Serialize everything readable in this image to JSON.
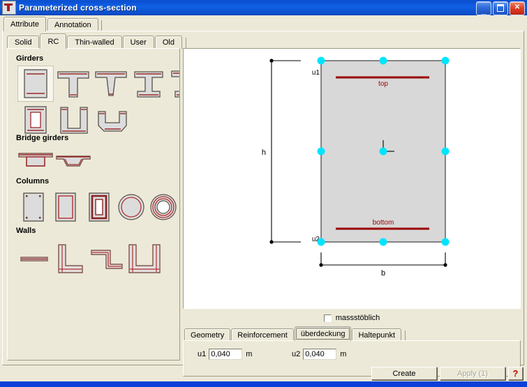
{
  "window": {
    "title": "Parameterized cross-section",
    "icon": "cross-section-icon",
    "buttons": {
      "minimize": "_",
      "maximize": "□",
      "close": "✕"
    },
    "titlebar_color": "#0a56d6"
  },
  "outer_tabs": [
    {
      "label": "Attribute",
      "selected": true
    },
    {
      "label": "Annotation",
      "selected": false
    }
  ],
  "inner_tabs": [
    {
      "label": "Solid",
      "selected": false
    },
    {
      "label": "RC",
      "selected": true
    },
    {
      "label": "Thin-walled",
      "selected": false
    },
    {
      "label": "User",
      "selected": false
    },
    {
      "label": "Old",
      "selected": false
    }
  ],
  "shape_palette": {
    "groups": [
      {
        "title": "Girders",
        "items": [
          {
            "name": "rectangle-girder",
            "selected": true
          },
          {
            "name": "t-beam-girder",
            "selected": false
          },
          {
            "name": "tapered-t-beam-girder",
            "selected": false
          },
          {
            "name": "i-beam-girder",
            "selected": false
          },
          {
            "name": "flanged-i-girder",
            "selected": false
          },
          {
            "name": "hollow-rectangle-girder",
            "selected": false
          },
          {
            "name": "u-channel-girder",
            "selected": false
          },
          {
            "name": "trapezoid-u-girder",
            "selected": false
          }
        ]
      },
      {
        "title": "Bridge girders",
        "items": [
          {
            "name": "box-bridge-girder",
            "selected": false
          },
          {
            "name": "trapezoidal-box-bridge-girder",
            "selected": false
          }
        ]
      },
      {
        "title": "Columns",
        "items": [
          {
            "name": "rectangular-column-corner-bars",
            "selected": false
          },
          {
            "name": "rectangular-column-stirrup",
            "selected": false
          },
          {
            "name": "hollow-rectangular-column",
            "selected": false
          },
          {
            "name": "circular-column",
            "selected": false
          },
          {
            "name": "annular-column",
            "selected": false
          }
        ]
      },
      {
        "title": "Walls",
        "items": [
          {
            "name": "straight-wall",
            "selected": false
          },
          {
            "name": "l-shaped-wall",
            "selected": false
          },
          {
            "name": "z-shaped-wall",
            "selected": false
          },
          {
            "name": "u-shaped-wall",
            "selected": false
          }
        ]
      }
    ]
  },
  "canvas": {
    "labels": {
      "height_dim": "h",
      "width_dim": "b",
      "cover_top": "u1",
      "cover_bottom": "u2",
      "rebar_top": "top",
      "rebar_bottom": "bottom"
    },
    "colors": {
      "section_fill": "#d8d8d8",
      "section_outline": "#404040",
      "handle": "#00e4ff",
      "rebar": "#990000",
      "dimension": "#000000"
    },
    "handle_count": 8
  },
  "scale_checkbox": {
    "label": "massstöblich",
    "checked": false
  },
  "bottom_tabs": [
    {
      "label": "Geometry",
      "selected": false
    },
    {
      "label": "Reinforcement",
      "selected": false
    },
    {
      "label": "überdeckung",
      "selected": true
    },
    {
      "label": "Haltepunkt",
      "selected": false
    }
  ],
  "cover_fields": [
    {
      "label": "u1",
      "value": "0,040",
      "unit": "m"
    },
    {
      "label": "u2",
      "value": "0,040",
      "unit": "m"
    }
  ],
  "actions": [
    {
      "label": "Create",
      "name": "create-button",
      "enabled": true
    },
    {
      "label": "Apply (1)",
      "name": "apply-button",
      "enabled": false
    },
    {
      "label": "?",
      "name": "help-button",
      "enabled": true
    }
  ]
}
